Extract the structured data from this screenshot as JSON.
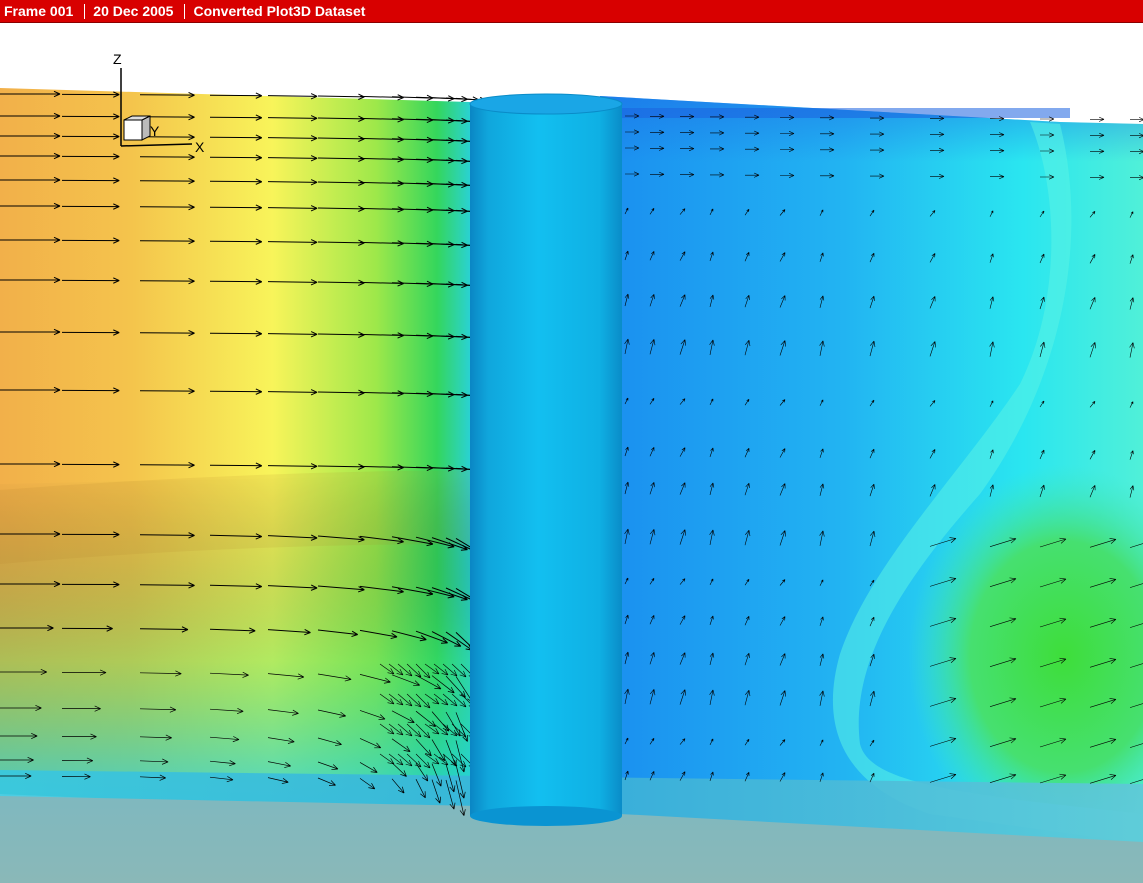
{
  "header": {
    "frame_label": "Frame 001",
    "date_label": "20 Dec 2005",
    "dataset_title": "Converted Plot3D Dataset"
  },
  "colors": {
    "header_bg": "#d80000",
    "header_text": "#ffffff",
    "cylinder": "#0fb4e6",
    "floor": "#84b8bc",
    "inflow_warm": "#f2b04a",
    "inflow_yellow": "#f8f45a",
    "mid_green": "#3fd84a",
    "wake_blue": "#1e96f0",
    "wake_cyan": "#28e6ee",
    "vector_color": "#000000"
  },
  "axis_triad": {
    "z_label": "Z",
    "y_label": "Y",
    "x_label": "X"
  },
  "scene": {
    "objects": [
      "cylinder",
      "velocity-vector-field",
      "contour-planes",
      "ground-plane"
    ]
  }
}
